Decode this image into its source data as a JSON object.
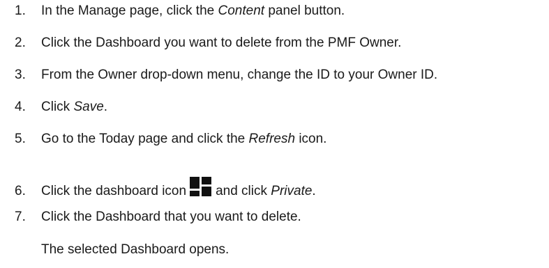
{
  "steps": [
    {
      "number": "1.",
      "before": "In the Manage page, click the ",
      "emphasis": "Content",
      "after": " panel button."
    },
    {
      "number": "2.",
      "text": "Click the Dashboard you want to delete from the PMF Owner."
    },
    {
      "number": "3.",
      "text": "From the Owner drop-down menu, change the ID to your Owner ID."
    },
    {
      "number": "4.",
      "before": "Click ",
      "emphasis": "Save",
      "after": "."
    },
    {
      "number": "5.",
      "before": "Go to the Today page and click the ",
      "emphasis": "Refresh",
      "after": " icon."
    },
    {
      "number": "6.",
      "before": "Click the dashboard icon",
      "icon": "dashboard-icon",
      "middle": "and click ",
      "emphasis": "Private",
      "after": "."
    },
    {
      "number": "7.",
      "text": "Click the Dashboard that you want to delete."
    }
  ],
  "result_text": "The selected Dashboard opens."
}
